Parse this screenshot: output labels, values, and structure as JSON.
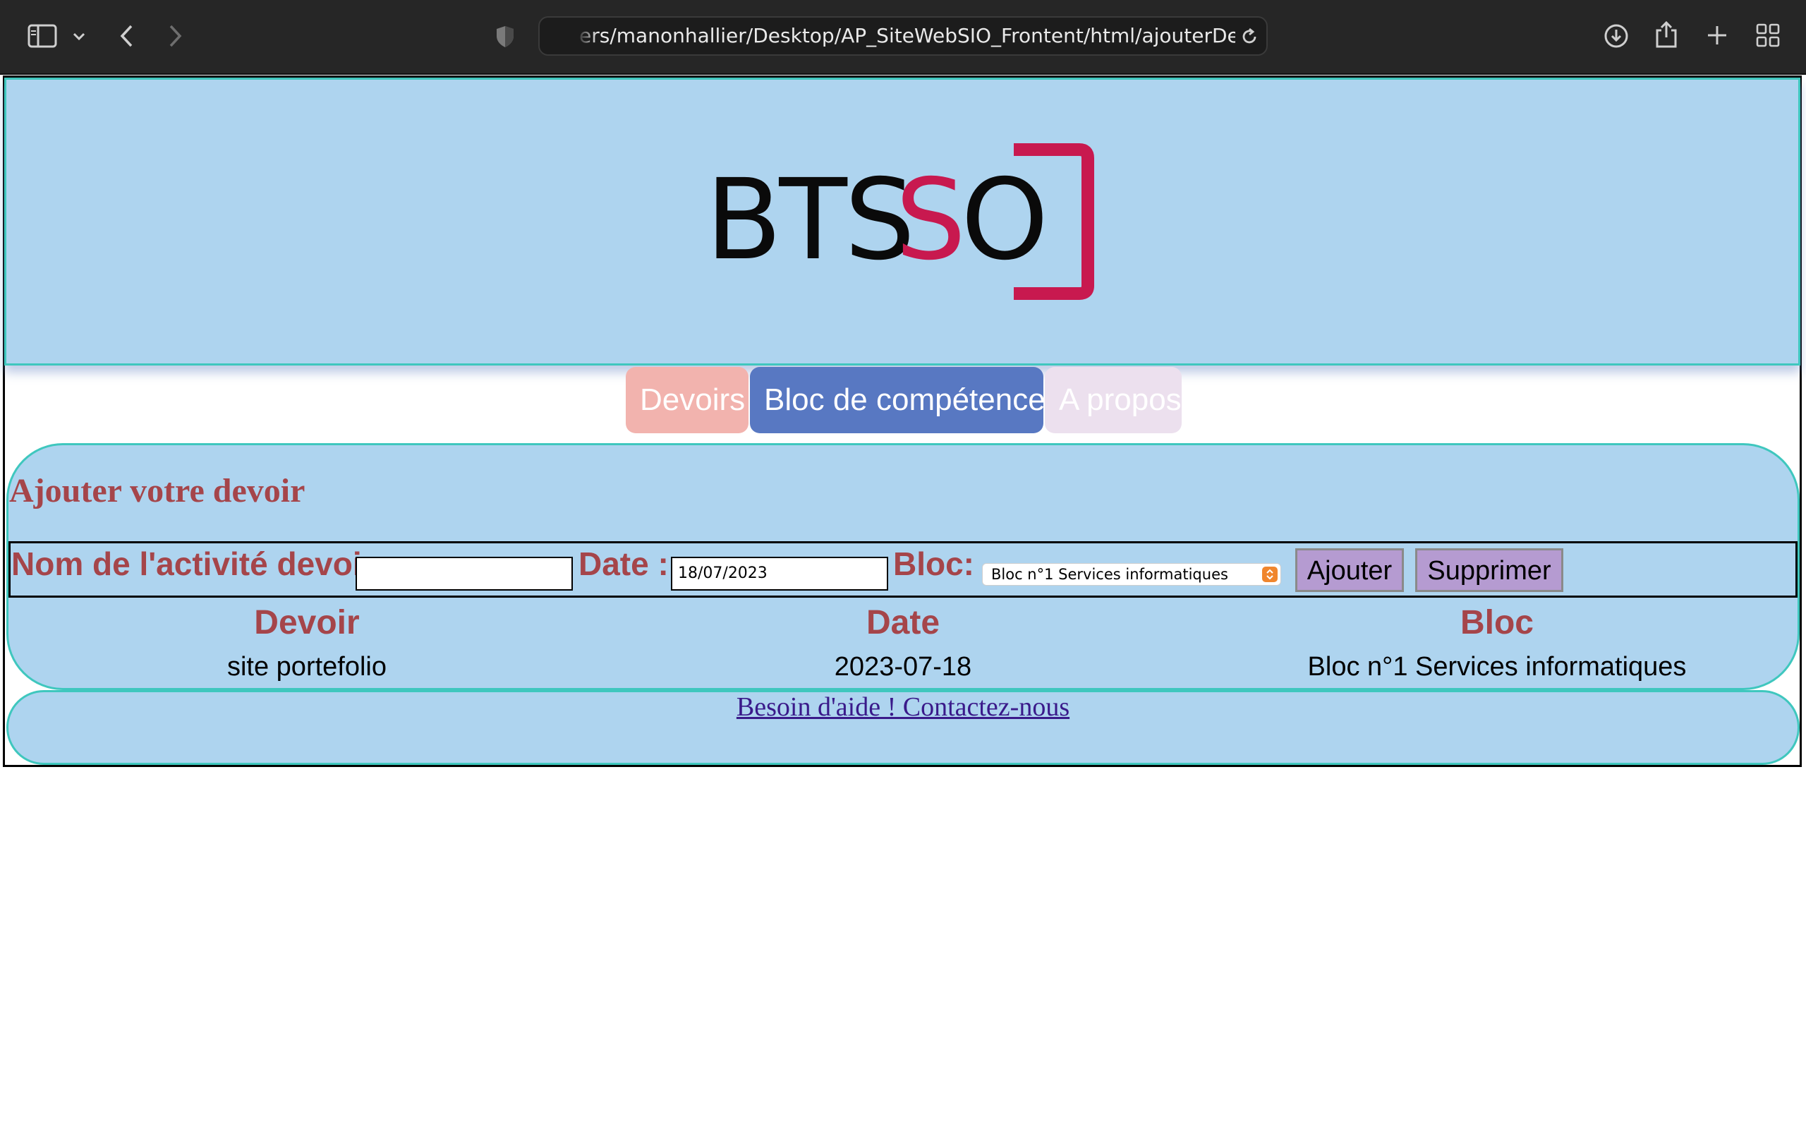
{
  "browser": {
    "url": "ers/manonhallier/Desktop/AP_SiteWebSIO_Frontent/html/ajouterDevoir.html",
    "icons": {
      "sidebar": "sidebar-icon",
      "tab_overview_menu": "chevron-down-icon",
      "back": "back-arrow-icon",
      "forward": "forward-arrow-icon",
      "privacy": "shield-icon",
      "reload": "reload-icon",
      "downloads": "download-icon",
      "share": "share-icon",
      "new_tab": "plus-icon",
      "tab_overview": "grid-icon"
    }
  },
  "header": {
    "logo": {
      "part1": "BTS",
      "part2": "SIO"
    }
  },
  "nav": {
    "items": [
      {
        "label": "Devoirs"
      },
      {
        "label": "Bloc de compétences"
      },
      {
        "label": "A propos"
      }
    ]
  },
  "section": {
    "title": "Ajouter votre devoir",
    "form": {
      "name_label": "Nom de l'activité devoir",
      "name_value": "",
      "date_label": "Date :",
      "date_value": "18/07/2023",
      "bloc_label": "Bloc:",
      "bloc_selected": "Bloc n°1 Services informatiques",
      "add_button": "Ajouter",
      "delete_button": "Supprimer"
    },
    "table": {
      "headers": [
        "Devoir",
        "Date",
        "Bloc"
      ],
      "rows": [
        [
          "site portefolio",
          "2023-07-18",
          "Bloc n°1 Services informatiques"
        ]
      ]
    }
  },
  "footer": {
    "help_link": "Besoin d'aide ! Contactez-nous"
  },
  "colors": {
    "page_bg": "#aed4ef",
    "accent_border": "#3fc7be",
    "heading": "#a5454a",
    "nav_devoirs": "#f2b3ae",
    "nav_bloc": "#5878c2",
    "nav_apropos": "#ece0ee",
    "button": "#b59bd1",
    "logo_accent": "#c8194f"
  }
}
